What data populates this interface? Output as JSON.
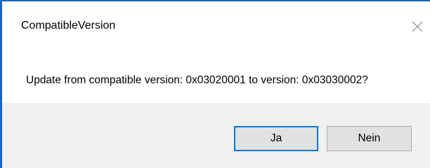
{
  "dialog": {
    "title": "CompatibleVersion",
    "message": "Update from compatible version: 0x03020001 to version: 0x03030002?",
    "close_icon": "close-icon",
    "buttons": {
      "yes_label": "Ja",
      "no_label": "Nein"
    }
  },
  "colors": {
    "window_border": "#1565c0",
    "footer_background": "#f0f0f0",
    "default_button_border": "#0078d7",
    "button_background": "#e1e1e1"
  }
}
